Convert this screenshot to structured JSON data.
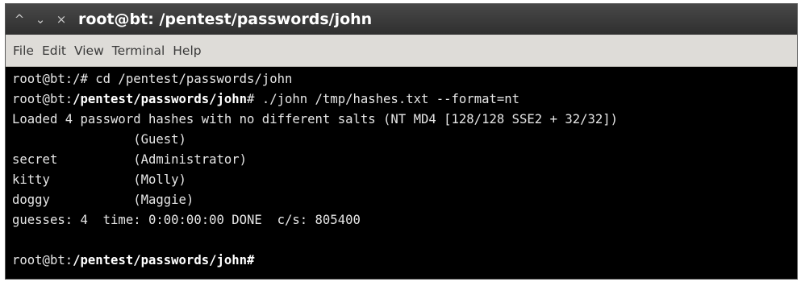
{
  "window": {
    "title": "root@bt: /pentest/passwords/john",
    "controls": {
      "minimize": "^",
      "maximize": "⌄",
      "close": "×"
    }
  },
  "menu": {
    "file": "File",
    "edit": "Edit",
    "view": "View",
    "terminal": "Terminal",
    "help": "Help"
  },
  "terminal": {
    "line1": "root@bt:/# cd /pentest/passwords/john",
    "line2_prompt_user": "root@bt:",
    "line2_prompt_path": "/pentest/passwords/john",
    "line2_prompt_end": "# ",
    "line2_cmd": "./john /tmp/hashes.txt --format=nt",
    "line3": "Loaded 4 password hashes with no different salts (NT MD4 [128/128 SSE2 + 32/32])",
    "line4": "                (Guest)",
    "line5": "secret          (Administrator)",
    "line6": "kitty           (Molly)",
    "line7": "doggy           (Maggie)",
    "line8": "guesses: 4  time: 0:00:00:00 DONE  c/s: 805400",
    "line10_prompt_user": "root@bt:",
    "line10_prompt_path": "/pentest/passwords/john",
    "line10_prompt_end": "#"
  },
  "colors": {
    "terminal_bg": "#000000",
    "terminal_fg": "#e6e6e6",
    "titlebar_bg": "#3a3a3a",
    "menubar_bg": "#dedcd8"
  }
}
